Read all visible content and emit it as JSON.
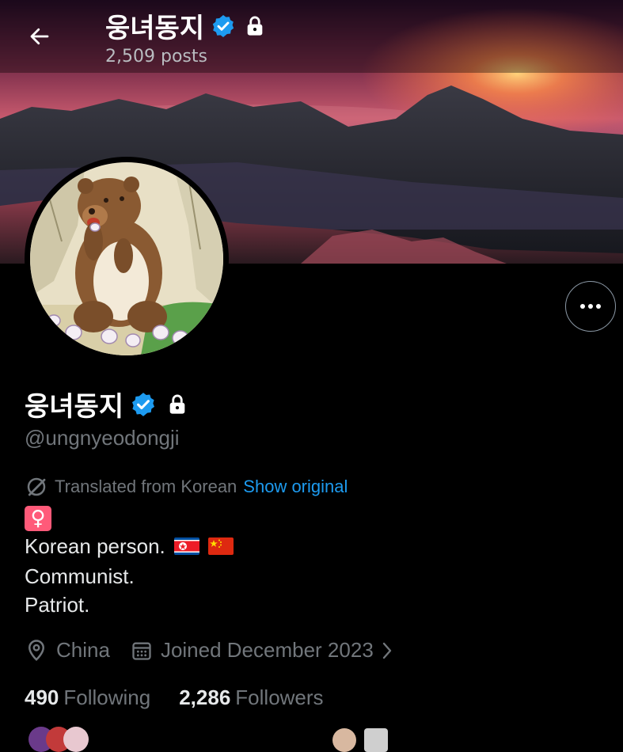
{
  "header": {
    "back_icon": "arrow-left-icon",
    "display_name": "웅녀동지",
    "posts_count": "2,509 posts"
  },
  "profile": {
    "display_name": "웅녀동지",
    "handle": "@ungnyeodongji",
    "verified_icon": "verified-badge-icon",
    "protected_icon": "lock-icon",
    "verified_color": "#1d9bf0",
    "more_icon": "ellipsis-icon"
  },
  "translation": {
    "icon": "translate-icon",
    "label": "Translated from Korean",
    "link": "Show original"
  },
  "bio": {
    "emoji": "♀",
    "lines": [
      "Korean person.",
      "Communist.",
      "Patriot."
    ],
    "flags": [
      "north-korea-flag",
      "china-flag"
    ]
  },
  "meta": {
    "location": "China",
    "location_icon": "location-pin-icon",
    "joined": "Joined December 2023",
    "joined_icon": "calendar-icon",
    "chevron_icon": "chevron-right-icon"
  },
  "stats": {
    "following_count": "490",
    "following_label": "Following",
    "followers_count": "2,286",
    "followers_label": "Followers"
  },
  "colors": {
    "background": "#000000",
    "text": "#e7e9ea",
    "muted": "#71767b",
    "link": "#1d9bf0"
  }
}
